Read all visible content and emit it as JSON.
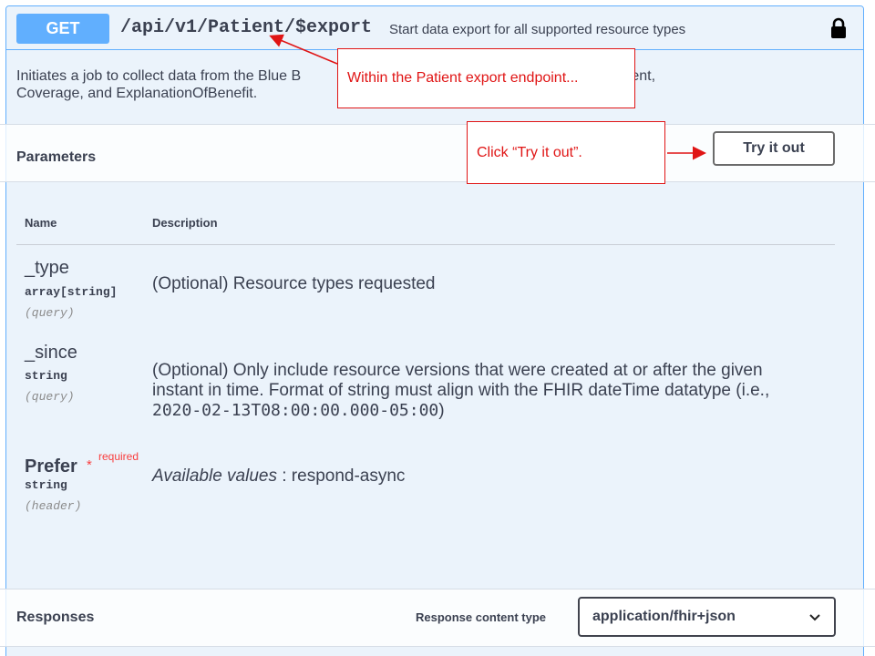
{
  "endpoint": {
    "method": "GET",
    "path": "/api/v1/Patient/$export",
    "summary": "Start data export for all supported resource types",
    "description_line1": "Initiates a job to collect data from the Blue B",
    "description_line1_end": "ce types are Patient,",
    "description_line2": "Coverage, and ExplanationOfBenefit.",
    "lock_icon": "lock-icon"
  },
  "parameters": {
    "title": "Parameters",
    "try_label": "Try it out",
    "col_name": "Name",
    "col_description": "Description",
    "items": [
      {
        "name": "_type",
        "type": "array[string]",
        "in": "(query)",
        "description": "(Optional) Resource types requested"
      },
      {
        "name": "_since",
        "type": "string",
        "in": "(query)",
        "description_l1": "(Optional) Only include resource versions that were created at or after the given",
        "description_l2": "instant in time. Format of string must align with the FHIR dateTime datatype (i.e.,",
        "description_code": "2020-02-13T08:00:00.000-05:00",
        "description_tail": ")"
      },
      {
        "name": "Prefer",
        "required_star": "*",
        "required_label": "required",
        "type": "string",
        "in": "(header)",
        "available_label": "Available values",
        "available_value": " : respond-async"
      }
    ]
  },
  "responses": {
    "title": "Responses",
    "content_type_label": "Response content type",
    "content_type_value": "application/fhir+json"
  },
  "annotations": {
    "callout1": "Within the Patient export endpoint...",
    "callout2": "Click “Try it out”.",
    "color": "#e01515"
  },
  "colors": {
    "get_blue": "#61affe",
    "block_bg": "#ebf3fb",
    "required_red": "#f93e3e"
  }
}
